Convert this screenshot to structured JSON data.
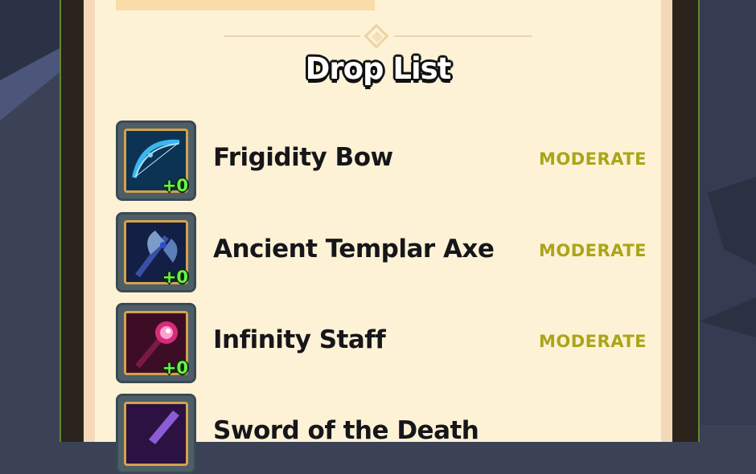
{
  "panel": {
    "title": "Drop List"
  },
  "drops": [
    {
      "name": "Frigidity Bow",
      "enhancement": "+0",
      "rarity": "MODERATE",
      "icon": "ice-bow-icon"
    },
    {
      "name": "Ancient Templar Axe",
      "enhancement": "+0",
      "rarity": "MODERATE",
      "icon": "templar-axe-icon"
    },
    {
      "name": "Infinity Staff",
      "enhancement": "+0",
      "rarity": "MODERATE",
      "icon": "infinity-staff-icon"
    },
    {
      "name": "Sword of the Death",
      "enhancement": "",
      "rarity": "",
      "icon": "death-sword-icon"
    }
  ],
  "colors": {
    "rarity_moderate": "#aaa518",
    "enhancement": "#6ef04a",
    "panel": "#fdf2d6"
  }
}
